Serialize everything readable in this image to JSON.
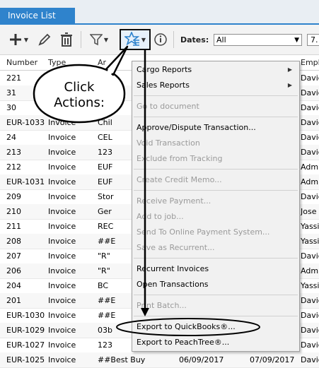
{
  "tab": {
    "label": "Invoice List"
  },
  "toolbar": {
    "dates_label": "Dates:",
    "dates_value": "All",
    "extra_value": "7."
  },
  "columns": [
    "Number",
    "Type",
    "Ar",
    "Empl"
  ],
  "rows": [
    {
      "number": "221",
      "type": "",
      "ar": "",
      "emp": "Davic"
    },
    {
      "number": "31",
      "type": "",
      "ar": "",
      "emp": "Davic"
    },
    {
      "number": "30",
      "type": "",
      "ar": "",
      "emp": "Davic"
    },
    {
      "number": "EUR-1033",
      "type": "Invoice",
      "ar": "Chil",
      "emp": "Davic"
    },
    {
      "number": "24",
      "type": "Invoice",
      "ar": "CEL",
      "emp": "Davic"
    },
    {
      "number": "213",
      "type": "Invoice",
      "ar": "123",
      "emp": "Davic"
    },
    {
      "number": "212",
      "type": "Invoice",
      "ar": "EUF",
      "emp": "Admir"
    },
    {
      "number": "EUR-1031",
      "type": "Invoice",
      "ar": "EUF",
      "emp": "Admir"
    },
    {
      "number": "209",
      "type": "Invoice",
      "ar": "Stor",
      "emp": "Davic"
    },
    {
      "number": "210",
      "type": "Invoice",
      "ar": "Ger",
      "emp": "Jose"
    },
    {
      "number": "211",
      "type": "Invoice",
      "ar": "REC",
      "emp": "Yassi"
    },
    {
      "number": "208",
      "type": "Invoice",
      "ar": "##E",
      "emp": "Yassi"
    },
    {
      "number": "207",
      "type": "Invoice",
      "ar": "\"R\"",
      "emp": "Davic"
    },
    {
      "number": "206",
      "type": "Invoice",
      "ar": "\"R\"",
      "emp": "Admir"
    },
    {
      "number": "204",
      "type": "Invoice",
      "ar": "BC",
      "emp": "Yassi"
    },
    {
      "number": "201",
      "type": "Invoice",
      "ar": "##E",
      "emp": "Davic"
    },
    {
      "number": "EUR-1030",
      "type": "Invoice",
      "ar": "##E",
      "emp": "Davic"
    },
    {
      "number": "EUR-1029",
      "type": "Invoice",
      "ar": "03b",
      "emp": "Davic"
    },
    {
      "number": "EUR-1027",
      "type": "Invoice",
      "ar": "123",
      "emp": "Davic"
    },
    {
      "number": "EUR-1025",
      "type": "Invoice",
      "ar": "##Best Buy",
      "date1": "06/09/2017",
      "date2": "07/09/2017",
      "emp": "Davic"
    }
  ],
  "menu": {
    "items": [
      {
        "label": "Cargo Reports",
        "disabled": false,
        "submenu": true
      },
      {
        "label": "Sales Reports",
        "disabled": false,
        "submenu": true
      },
      {
        "label": "Go to document",
        "disabled": true
      },
      {
        "label": "Approve/Dispute Transaction...",
        "disabled": false
      },
      {
        "label": "Void Transaction",
        "disabled": true
      },
      {
        "label": "Exclude from Tracking",
        "disabled": true
      },
      {
        "label": "Create Credit Memo...",
        "disabled": true
      },
      {
        "label": "Receive Payment...",
        "disabled": true
      },
      {
        "label": "Add to job...",
        "disabled": true
      },
      {
        "label": "Send To Online Payment System...",
        "disabled": true
      },
      {
        "label": "Save as Recurrent...",
        "disabled": true
      },
      {
        "label": "Recurrent Invoices",
        "disabled": false
      },
      {
        "label": "Open Transactions",
        "disabled": false
      },
      {
        "label": "Print Batch...",
        "disabled": true
      },
      {
        "label": "Export to QuickBooks®...",
        "disabled": false
      },
      {
        "label": "Export to PeachTree®...",
        "disabled": false
      }
    ]
  },
  "callout": {
    "line1": "Click",
    "line2": "Actions:"
  },
  "colors": {
    "tab": "#2f83cc",
    "menu_bg": "#f1f1f1",
    "disabled_text": "#9a9a9a",
    "actions_icon": "#2f83cc"
  }
}
